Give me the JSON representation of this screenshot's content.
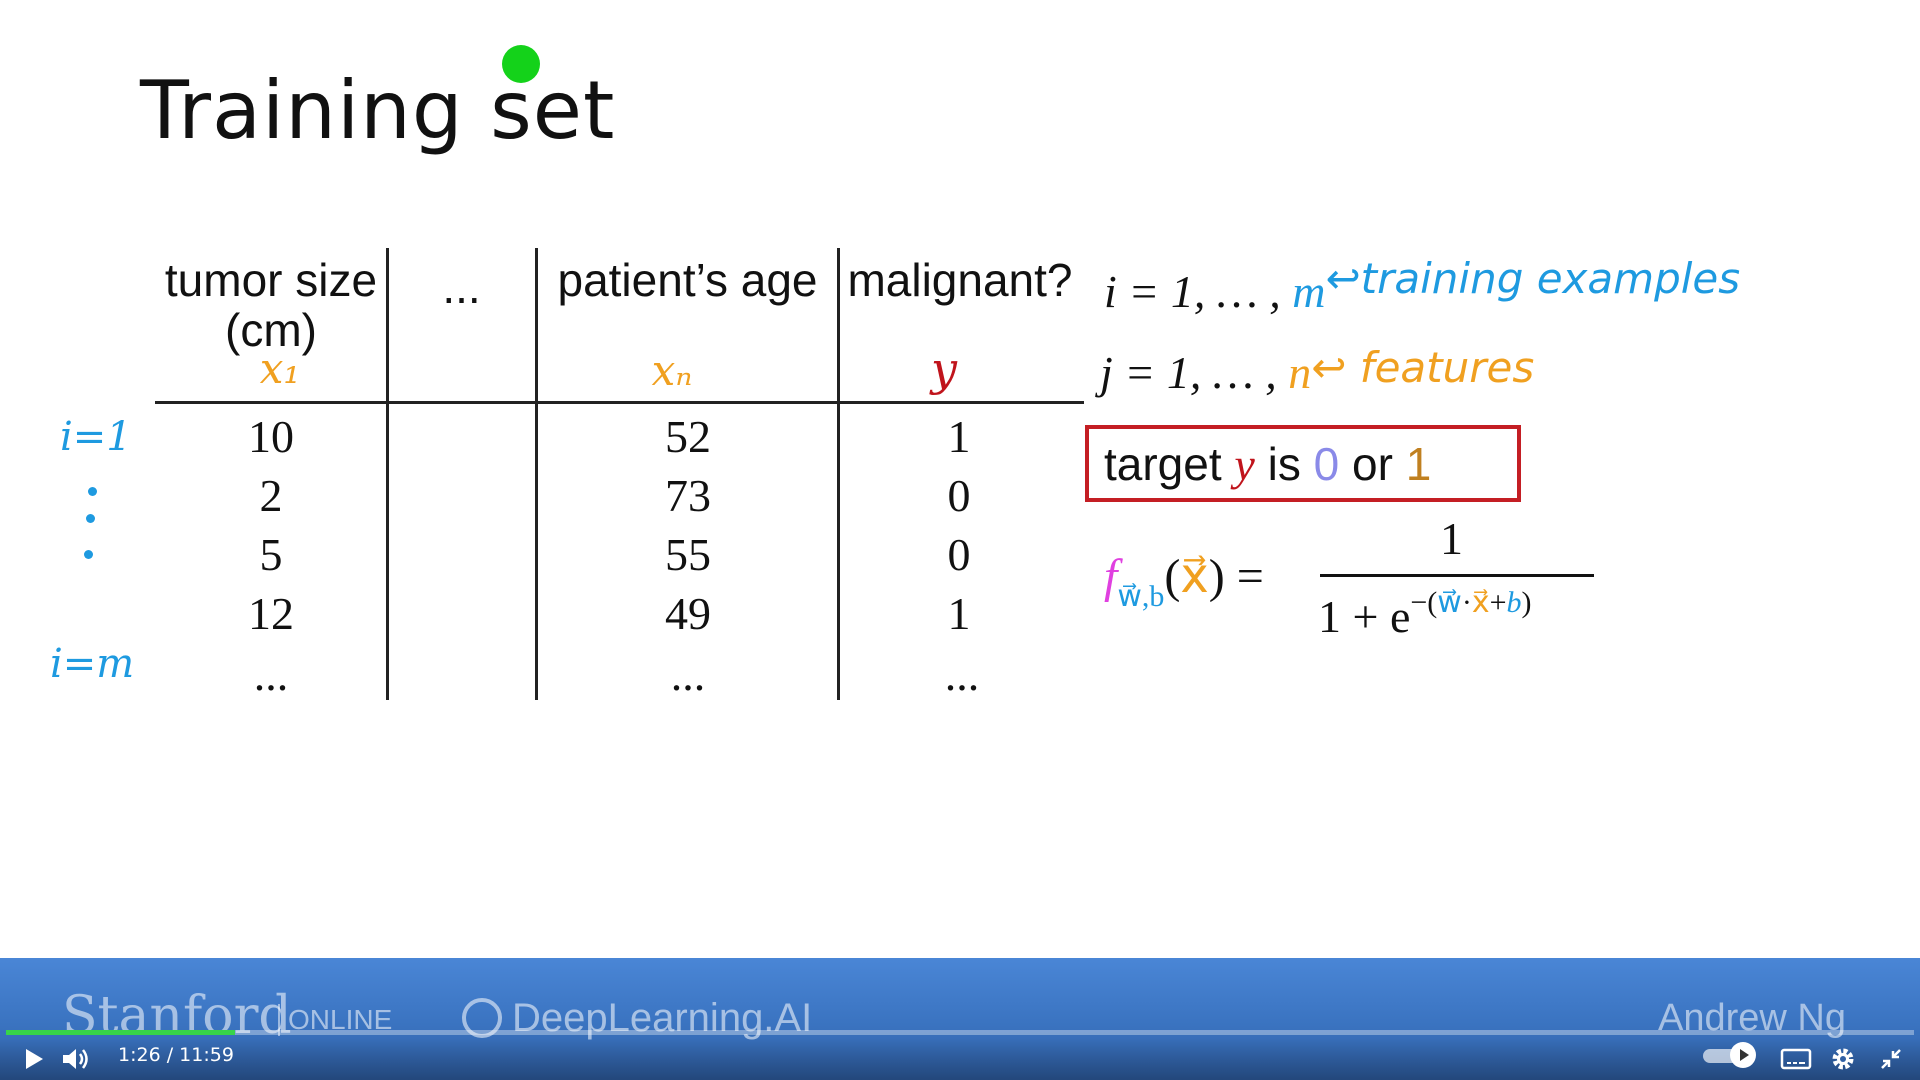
{
  "slide": {
    "title": "Training set",
    "table": {
      "headers": {
        "col1_line1": "tumor size",
        "col1_line2": "(cm)",
        "col2": "...",
        "col3": "patient’s age",
        "col4": "malignant?"
      },
      "feature_labels": {
        "col1": "x₁",
        "col3": "xₙ",
        "col4": "y"
      },
      "rows": [
        [
          "10",
          "52",
          "1"
        ],
        [
          "2",
          "73",
          "0"
        ],
        [
          "5",
          "55",
          "0"
        ],
        [
          "12",
          "49",
          "1"
        ],
        [
          "...",
          "...",
          "..."
        ]
      ]
    },
    "index_labels": {
      "first": "i=1",
      "last": "i=m"
    },
    "notes": {
      "i_eq": "i = 1, … , ",
      "i_m": "m",
      "i_annotation": "↩training examples",
      "j_eq": "j = 1, … , ",
      "j_n": "n",
      "j_annotation": "↩ features"
    },
    "target": {
      "t1": "target ",
      "y": "y",
      "t2": " is ",
      "zero": "0",
      "t3": " or ",
      "one": "1"
    },
    "formula": {
      "f": "f",
      "subscript": "w⃗,b",
      "open": "(",
      "x": "x⃗",
      "close": ") =",
      "numerator": "1",
      "denom_base": "1 + e",
      "exp_minus": "−(",
      "exp_w": "w⃗",
      "exp_dot": "·",
      "exp_x": "x⃗",
      "exp_plus": "+",
      "exp_b": "b",
      "exp_close": ")"
    }
  },
  "player": {
    "brand_stanford": "Stanford",
    "brand_online": "ONLINE",
    "brand_deeplearning": "DeepLearning.AI",
    "author": "Andrew Ng",
    "current_time": "1:26",
    "separator": "/",
    "duration": "11:59",
    "progress": 0.12,
    "icons": {
      "play": "play-icon",
      "volume": "volume-icon",
      "autoplay": "autoplay-toggle",
      "captions": "captions-icon",
      "settings": "gear-icon",
      "exit_fullscreen": "exit-fullscreen-icon"
    }
  }
}
